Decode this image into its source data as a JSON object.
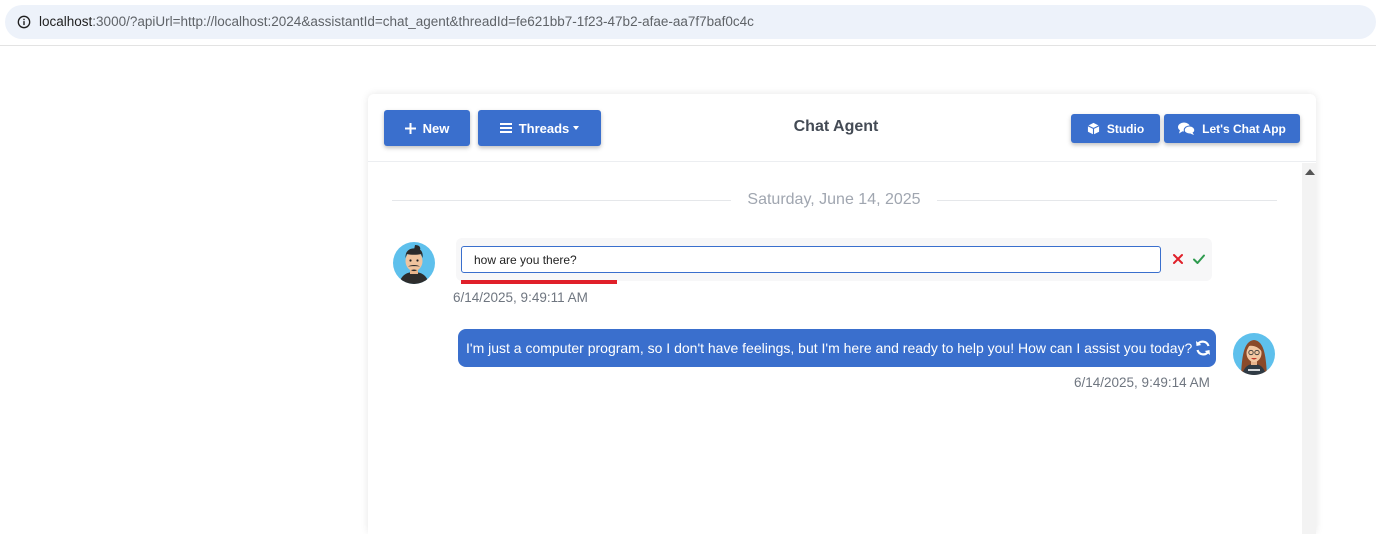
{
  "browser": {
    "url_host": "localhost",
    "url_rest": ":3000/?apiUrl=http://localhost:2024&assistantId=chat_agent&threadId=fe621bb7-1f23-47b2-afae-aa7f7baf0c4c",
    "info_icon": "info-icon"
  },
  "toolbar": {
    "new_label": "New",
    "threads_label": "Threads",
    "title": "Chat Agent",
    "studio_label": "Studio",
    "chat_app_label": "Let's Chat App"
  },
  "chat": {
    "date_divider": "Saturday, June 14, 2025",
    "user_message": {
      "edit_value": "how are you there?",
      "timestamp": "6/14/2025, 9:49:11 AM"
    },
    "bot_message": {
      "text": "I'm just a computer program, so I don't have feelings, but I'm here and ready to help you! How can I assist you today?",
      "timestamp": "6/14/2025, 9:49:14 AM"
    }
  },
  "colors": {
    "accent": "#3a6fcd",
    "cancel": "#e0202a",
    "confirm": "#2e9a4e",
    "muted_text": "#6f7680"
  }
}
